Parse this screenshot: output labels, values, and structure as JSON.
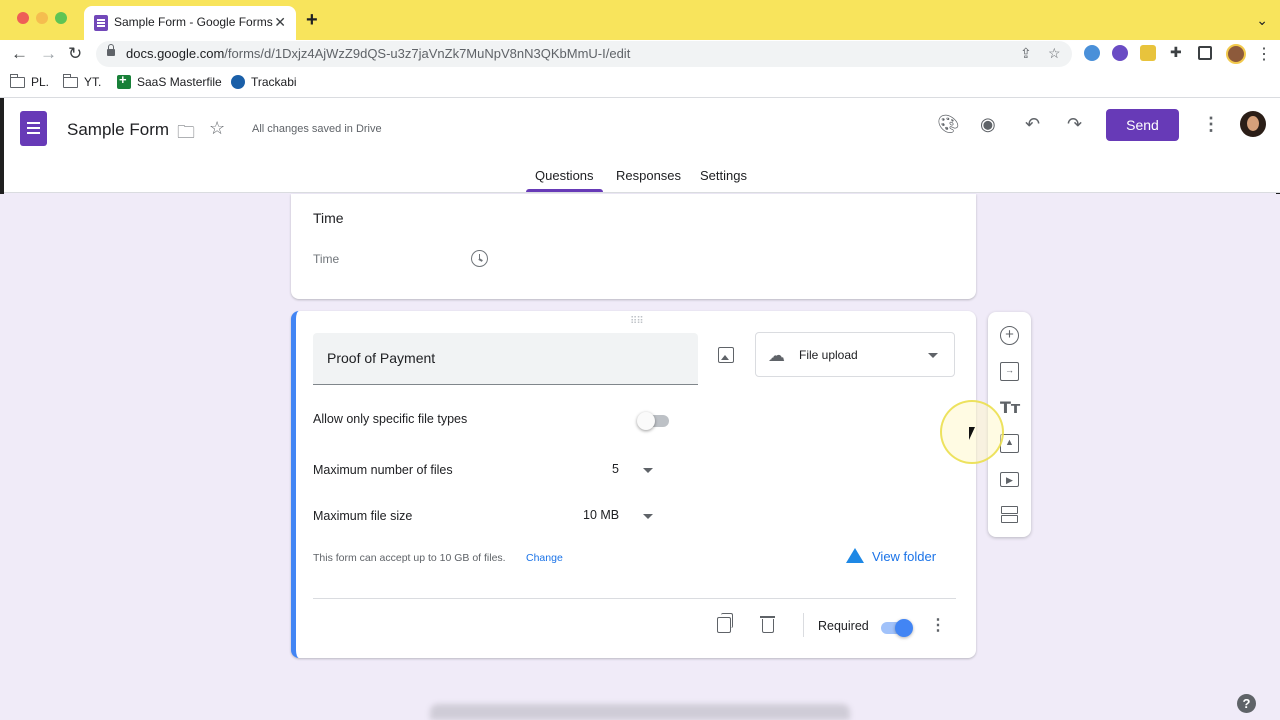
{
  "browser": {
    "tab_title": "Sample Form - Google Forms",
    "url_host": "docs.google.com",
    "url_path": "/forms/d/1Dxjz4AjWzZ9dQS-u3z7jaVnZk7MuNpV8nN3QKbMmU-I/edit",
    "bookmarks": [
      {
        "label": "PL.",
        "icon": "folder-icon"
      },
      {
        "label": "YT.",
        "icon": "folder-icon"
      },
      {
        "label": "SaaS Masterfile",
        "icon": "sheets-icon"
      },
      {
        "label": "Trackabi",
        "icon": "trackabi-icon"
      }
    ]
  },
  "header": {
    "title": "Sample Form",
    "save_status": "All changes saved in Drive",
    "send_label": "Send",
    "tabs": [
      {
        "label": "Questions",
        "active": true
      },
      {
        "label": "Responses",
        "active": false
      },
      {
        "label": "Settings",
        "active": false
      }
    ]
  },
  "time_question": {
    "title": "Time",
    "field_placeholder": "Time"
  },
  "upload_question": {
    "title": "Proof of Payment",
    "type": "File upload",
    "allow_specific_types_label": "Allow only specific file types",
    "allow_specific_types": false,
    "max_files_label": "Maximum number of files",
    "max_files_value": "5",
    "max_size_label": "Maximum file size",
    "max_size_value": "10 MB",
    "note": "This form can accept up to 10 GB of files.",
    "change_link": "Change",
    "view_folder": "View folder",
    "required_label": "Required",
    "required": true
  },
  "side_toolbar": [
    "add-question-icon",
    "import-questions-icon",
    "add-title-icon",
    "add-image-icon",
    "add-video-icon",
    "add-section-icon"
  ],
  "colors": {
    "accent": "#673ab7",
    "background": "#f0ebf8",
    "active_card_border": "#4285f4",
    "chrome_tabstrip": "#f8e45c"
  }
}
